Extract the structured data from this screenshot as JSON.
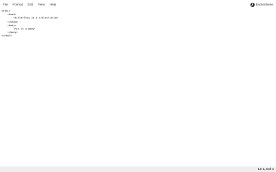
{
  "menubar": {
    "items": [
      {
        "label": "File"
      },
      {
        "label": "Format"
      },
      {
        "label": "Edit"
      },
      {
        "label": "View"
      },
      {
        "label": "Help"
      }
    ]
  },
  "user": {
    "icon": "user-circle-icon",
    "name": "backenlievie"
  },
  "editor": {
    "content": "<html>\n    <head>\n        <title>This is a title</title>\n    </head>\n    <body>\n        This is a body!\n    </body>\n</html>"
  },
  "statusbar": {
    "cursor": "Ln 1, Col 1"
  }
}
